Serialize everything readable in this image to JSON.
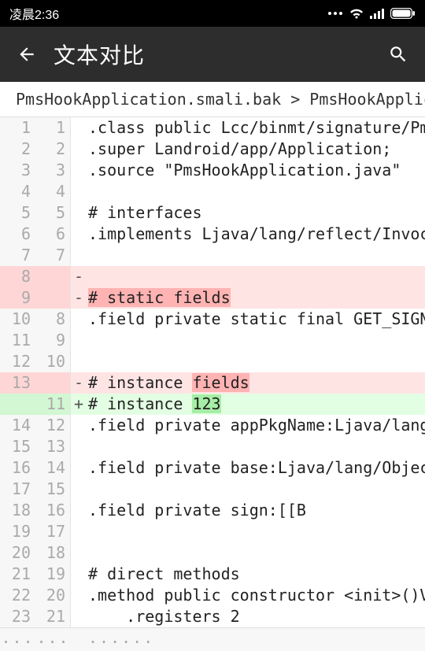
{
  "statusbar": {
    "time": "凌晨2:36"
  },
  "appbar": {
    "title": "文本对比"
  },
  "breadcrumb": {
    "left": "PmsHookApplication.smali.bak",
    "sep": ">",
    "right": "PmsHookApplication"
  },
  "footer": {
    "ell": "...",
    "dots": "......"
  },
  "lines": [
    {
      "l": "1",
      "r": "1",
      "s": " ",
      "t": ".class public Lcc/binmt/signature/PmsHoo"
    },
    {
      "l": "2",
      "r": "2",
      "s": " ",
      "t": ".super Landroid/app/Application;"
    },
    {
      "l": "3",
      "r": "3",
      "s": " ",
      "t": ".source \"PmsHookApplication.java\""
    },
    {
      "l": "4",
      "r": "4",
      "s": " ",
      "t": ""
    },
    {
      "l": "5",
      "r": "5",
      "s": " ",
      "t": "# interfaces"
    },
    {
      "l": "6",
      "r": "6",
      "s": " ",
      "t": ".implements Ljava/lang/reflect/Invocatio"
    },
    {
      "l": "7",
      "r": "7",
      "s": " ",
      "t": ""
    },
    {
      "l": "8",
      "r": "",
      "s": "-",
      "t": "",
      "kind": "del"
    },
    {
      "l": "9",
      "r": "",
      "s": "-",
      "pre": "",
      "hl": "# static fields",
      "post": "",
      "kind": "del"
    },
    {
      "l": "10",
      "r": "8",
      "s": " ",
      "t": ".field private static final GET_SIGNATUR"
    },
    {
      "l": "11",
      "r": "9",
      "s": " ",
      "t": ""
    },
    {
      "l": "12",
      "r": "10",
      "s": " ",
      "t": ""
    },
    {
      "l": "13",
      "r": "",
      "s": "-",
      "pre": "# instance ",
      "hl": "fields",
      "post": "",
      "kind": "del"
    },
    {
      "l": "",
      "r": "11",
      "s": "+",
      "pre": "# instance ",
      "hl": "123",
      "post": "",
      "kind": "add"
    },
    {
      "l": "14",
      "r": "12",
      "s": " ",
      "t": ".field private appPkgName:Ljava/lang/Str"
    },
    {
      "l": "15",
      "r": "13",
      "s": " ",
      "t": ""
    },
    {
      "l": "16",
      "r": "14",
      "s": " ",
      "t": ".field private base:Ljava/lang/Object;"
    },
    {
      "l": "17",
      "r": "15",
      "s": " ",
      "t": ""
    },
    {
      "l": "18",
      "r": "16",
      "s": " ",
      "t": ".field private sign:[[B"
    },
    {
      "l": "19",
      "r": "17",
      "s": " ",
      "t": ""
    },
    {
      "l": "20",
      "r": "18",
      "s": " ",
      "t": ""
    },
    {
      "l": "21",
      "r": "19",
      "s": " ",
      "t": "# direct methods"
    },
    {
      "l": "22",
      "r": "20",
      "s": " ",
      "t": ".method public constructor <init>()V"
    },
    {
      "l": "23",
      "r": "21",
      "s": " ",
      "t": "    .registers 2"
    }
  ]
}
